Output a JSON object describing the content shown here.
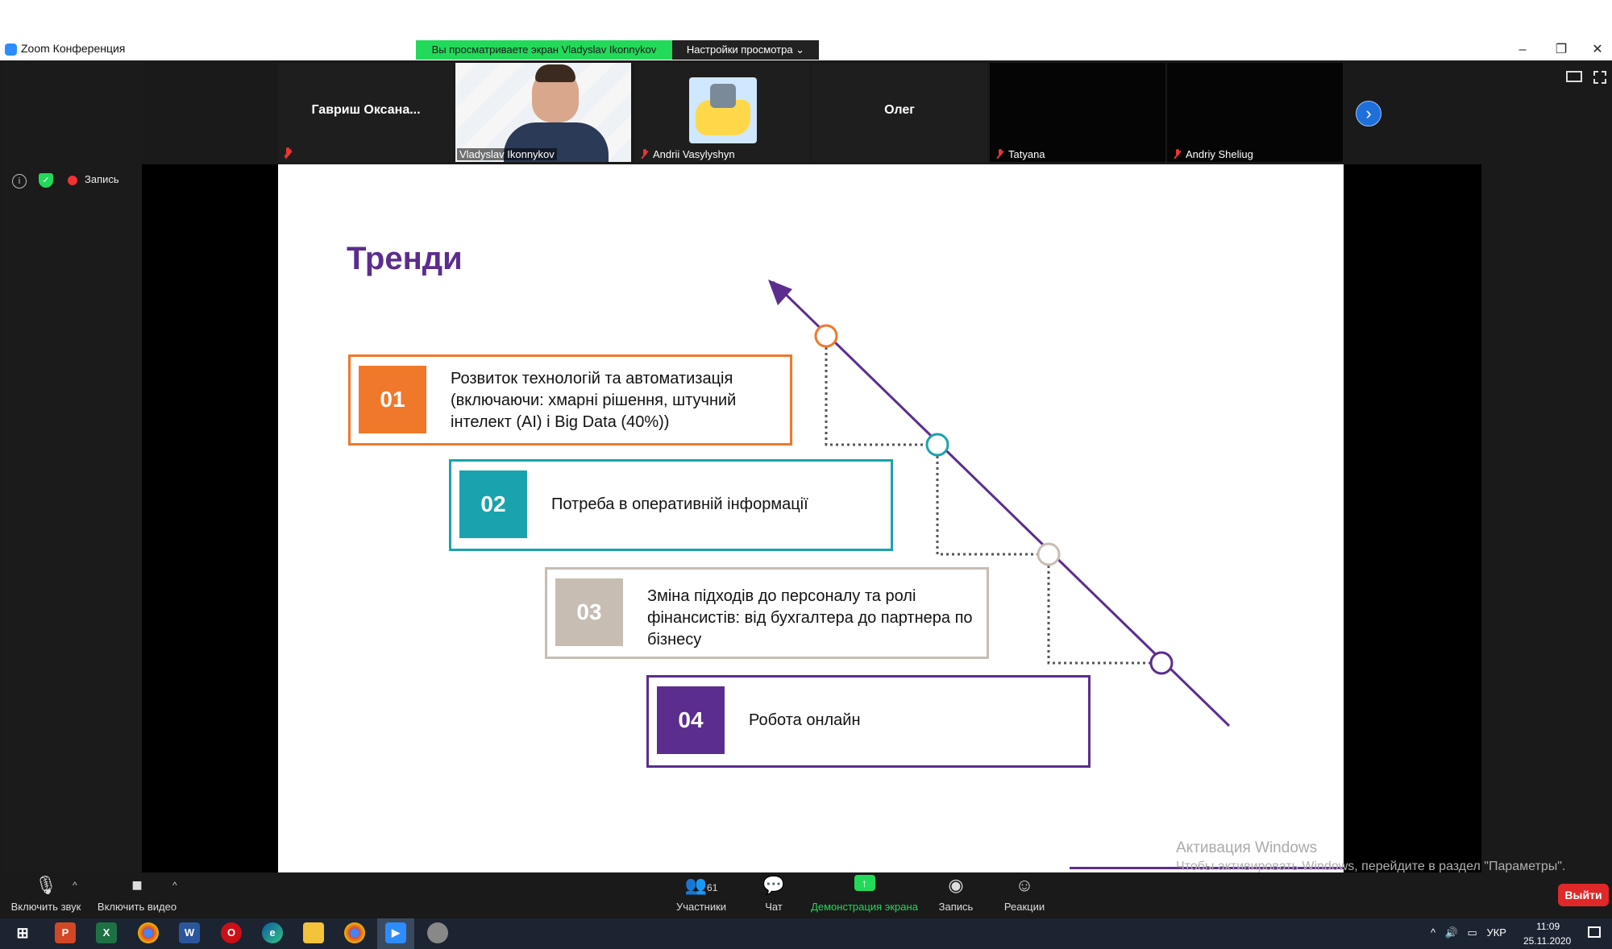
{
  "window": {
    "title": "Zoom Конференция",
    "share_banner": "Вы просматриваете экран Vladyslav Ikonnykov",
    "view_settings": "Настройки просмотра ⌄"
  },
  "participants": [
    {
      "name": "Гавриш  Оксана...",
      "label": ""
    },
    {
      "name": "",
      "label": "Vladyslav Ikonnykov"
    },
    {
      "name": "",
      "label": "Andrii Vasylyshyn"
    },
    {
      "name": "Олег",
      "label": ""
    },
    {
      "name": "",
      "label": "Tatyana"
    },
    {
      "name": "",
      "label": "Andriy Sheliug"
    }
  ],
  "status": {
    "record": "Запись"
  },
  "slide": {
    "title": "Тренди",
    "trends": [
      {
        "num": "01",
        "text": "Розвиток технологій та автоматизація (включаючи: хмарні рішення, штучний інтелект (AI) і Big Data (40%))",
        "color": "#F0782A"
      },
      {
        "num": "02",
        "text": "Потреба в оперативній інформації",
        "color": "#1AA3AE"
      },
      {
        "num": "03",
        "text": "Зміна підходів до персоналу та ролі фінансистів: від бухгалтера  до партнера по бізнесу",
        "color": "#C7BDB3"
      },
      {
        "num": "04",
        "text": "Робота онлайн",
        "color": "#5B2D8E"
      }
    ],
    "arrow_color": "#5B2D8E"
  },
  "watermark": {
    "line1": "Активация Windows",
    "line2": "Чтобы активировать Windows, перейдите в раздел \"Параметры\"."
  },
  "controls": {
    "unmute": "Включить звук",
    "start_video": "Включить видео",
    "participants": "Участники",
    "participants_count": "61",
    "chat": "Чат",
    "share": "Демонстрация экрана",
    "record": "Запись",
    "reactions": "Реакции",
    "exit": "Выйти"
  },
  "taskbar": {
    "lang": "УКР",
    "time": "11:09",
    "date": "25.11.2020"
  }
}
